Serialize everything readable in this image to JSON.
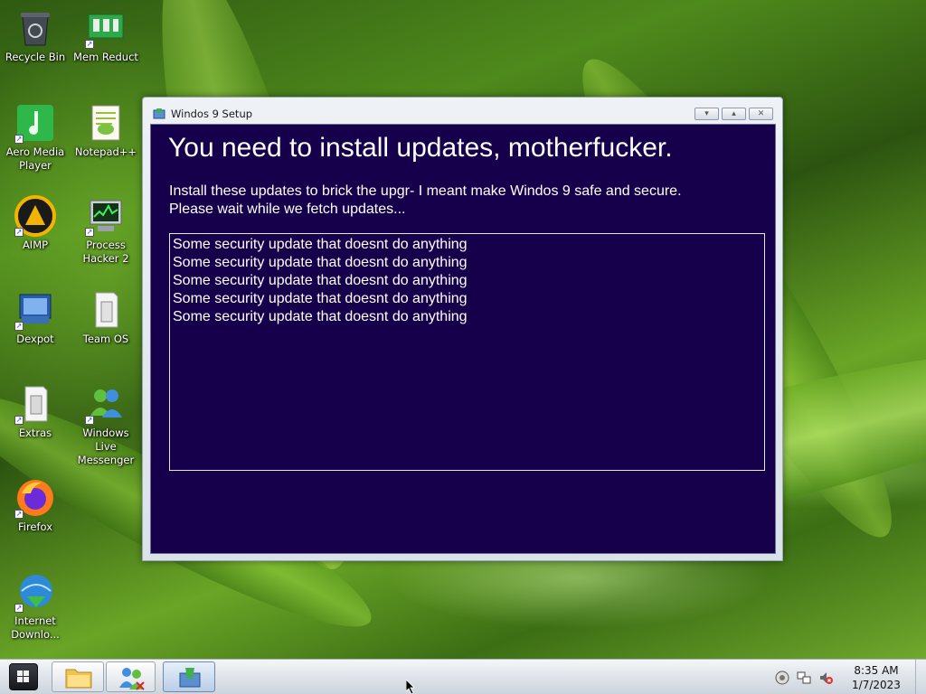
{
  "desktop": {
    "icons": [
      {
        "label": "Recycle Bin"
      },
      {
        "label": "Mem Reduct"
      },
      {
        "label": "Aero Media Player"
      },
      {
        "label": "Notepad++"
      },
      {
        "label": "AIMP"
      },
      {
        "label": "Process Hacker 2"
      },
      {
        "label": "Dexpot"
      },
      {
        "label": "Team OS"
      },
      {
        "label": "Extras"
      },
      {
        "label": "Windows Live Messenger"
      },
      {
        "label": "Firefox"
      },
      {
        "label": "Internet Downlo..."
      }
    ]
  },
  "window": {
    "title": "Windos 9 Setup",
    "heading": "You need to install updates, motherfucker.",
    "description_line1": "Install these updates to brick the upgr- I meant make Windos 9 safe and secure.",
    "description_line2": "Please wait while we fetch updates...",
    "updates": [
      "Some security update that doesnt do anything",
      "Some security update that doesnt do anything",
      "Some security update that doesnt do anything",
      "Some security update that doesnt do anything",
      "Some security update that doesnt do anything"
    ],
    "client_color": "#17004b"
  },
  "taskbar": {
    "time": "8:35 AM",
    "date": "1/7/2023"
  }
}
